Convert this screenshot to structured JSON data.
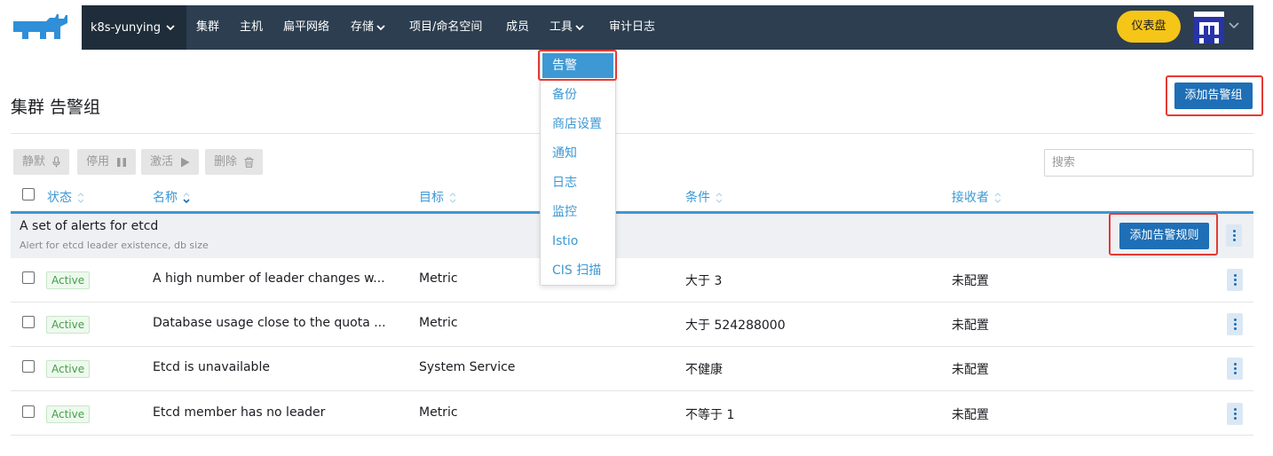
{
  "header": {
    "cluster": "k8s-yunying",
    "nav": [
      {
        "label": "集群",
        "has_dropdown": false
      },
      {
        "label": "主机",
        "has_dropdown": false
      },
      {
        "label": "扁平网络",
        "has_dropdown": false
      },
      {
        "label": "存储",
        "has_dropdown": true
      },
      {
        "label": "项目/命名空间",
        "has_dropdown": false
      },
      {
        "label": "成员",
        "has_dropdown": false
      },
      {
        "label": "工具",
        "has_dropdown": true
      },
      {
        "label": "审计日志",
        "has_dropdown": false
      }
    ],
    "dashboard_label": "仪表盘"
  },
  "tools_menu": {
    "items": [
      "告警",
      "备份",
      "商店设置",
      "通知",
      "日志",
      "监控",
      "Istio",
      "CIS 扫描"
    ],
    "active": "告警"
  },
  "page": {
    "title": "集群 告警组",
    "add_group_label": "添加告警组"
  },
  "toolbar": {
    "mute_label": "静默",
    "disable_label": "停用",
    "activate_label": "激活",
    "delete_label": "删除",
    "search_placeholder": "搜索"
  },
  "table": {
    "columns": [
      "状态",
      "名称",
      "目标",
      "条件",
      "接收者"
    ],
    "group": {
      "title": "A set of alerts for etcd",
      "description": "Alert for etcd leader existence, db size",
      "add_rule_label": "添加告警规则"
    },
    "rows": [
      {
        "status": "Active",
        "name": "A high number of leader changes within the etcd cluster are happening",
        "name_display": "A high number of leader changes w...",
        "target": "Metric",
        "condition": "大于 3",
        "receiver": "未配置"
      },
      {
        "status": "Active",
        "name": "Database usage close to the quota",
        "name_display": "Database usage close to the quota ...",
        "target": "Metric",
        "condition": "大于 524288000",
        "receiver": "未配置"
      },
      {
        "status": "Active",
        "name": "Etcd is unavailable",
        "name_display": "Etcd is unavailable",
        "target": "System Service",
        "condition": "不健康",
        "receiver": "未配置"
      },
      {
        "status": "Active",
        "name": "Etcd member has no leader",
        "name_display": "Etcd member has no leader",
        "target": "Metric",
        "condition": "不等于 1",
        "receiver": "未配置"
      }
    ]
  },
  "colors": {
    "nav_bg": "#2c3e50",
    "accent": "#3d98d3",
    "primary_button": "#1e6fb6",
    "dashboard_button": "#f5c518",
    "active_badge": "#43a047",
    "highlight": "#e53935"
  },
  "icons": {
    "logo": "rancher-logo",
    "mute": "microphone-icon",
    "disable": "pause-icon",
    "activate": "play-icon",
    "delete": "trash-icon",
    "sort": "sort-icon",
    "more": "kebab-menu-icon"
  }
}
